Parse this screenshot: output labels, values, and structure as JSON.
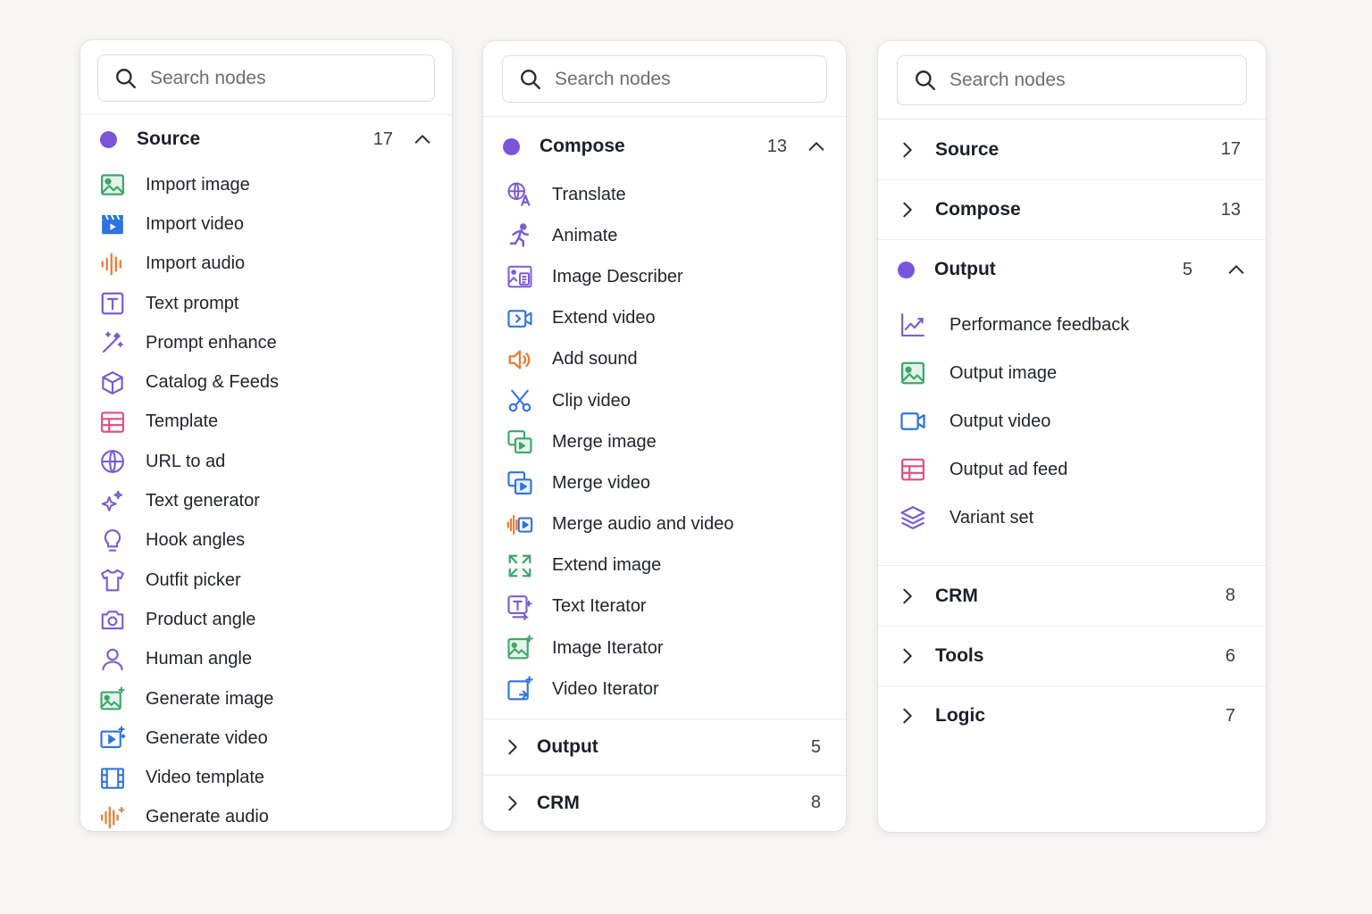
{
  "colors": {
    "accent_dot": "#7b54d9",
    "icon_green": "#3fa66a",
    "icon_blue": "#2f73e0",
    "icon_orange": "#ec7a33",
    "icon_purple": "#7b5bd6",
    "icon_pink": "#e14c7d"
  },
  "panels": [
    {
      "search_placeholder": "Search nodes",
      "expanded": {
        "title": "Source",
        "count": "17",
        "icon": "purple-dot"
      },
      "items": [
        {
          "label": "Import image",
          "icon": "image-icon"
        },
        {
          "label": "Import video",
          "icon": "clapperboard-icon"
        },
        {
          "label": "Import audio",
          "icon": "waveform-icon"
        },
        {
          "label": "Text prompt",
          "icon": "text-box-icon"
        },
        {
          "label": "Prompt enhance",
          "icon": "magic-wand-icon"
        },
        {
          "label": "Catalog & Feeds",
          "icon": "cube-icon"
        },
        {
          "label": "Template",
          "icon": "table-icon"
        },
        {
          "label": "URL to ad",
          "icon": "globe-icon"
        },
        {
          "label": "Text generator",
          "icon": "sparkles-icon"
        },
        {
          "label": "Hook angles",
          "icon": "lightbulb-icon"
        },
        {
          "label": "Outfit picker",
          "icon": "tshirt-icon"
        },
        {
          "label": "Product angle",
          "icon": "camera-icon"
        },
        {
          "label": "Human angle",
          "icon": "user-icon"
        },
        {
          "label": "Generate image",
          "icon": "image-sparkle-icon"
        },
        {
          "label": "Generate video",
          "icon": "video-sparkle-icon"
        },
        {
          "label": "Video template",
          "icon": "film-icon"
        },
        {
          "label": "Generate audio",
          "icon": "audio-sparkle-icon"
        }
      ]
    },
    {
      "search_placeholder": "Search nodes",
      "expanded": {
        "title": "Compose",
        "count": "13",
        "icon": "purple-dot"
      },
      "items": [
        {
          "label": "Translate",
          "icon": "translate-icon"
        },
        {
          "label": "Animate",
          "icon": "running-figure-icon"
        },
        {
          "label": "Image Describer",
          "icon": "image-text-icon"
        },
        {
          "label": "Extend video",
          "icon": "video-extend-icon"
        },
        {
          "label": "Add sound",
          "icon": "speaker-icon"
        },
        {
          "label": "Clip video",
          "icon": "scissors-icon"
        },
        {
          "label": "Merge image",
          "icon": "merge-image-icon"
        },
        {
          "label": "Merge video",
          "icon": "merge-video-icon"
        },
        {
          "label": "Merge audio and video",
          "icon": "merge-audio-video-icon"
        },
        {
          "label": "Extend image",
          "icon": "expand-icon"
        },
        {
          "label": "Text Iterator",
          "icon": "text-iterator-icon"
        },
        {
          "label": "Image Iterator",
          "icon": "image-iterator-icon"
        },
        {
          "label": "Video Iterator",
          "icon": "video-iterator-icon"
        }
      ],
      "collapsed": [
        {
          "title": "Output",
          "count": "5"
        },
        {
          "title": "CRM",
          "count": "8"
        }
      ]
    },
    {
      "search_placeholder": "Search nodes",
      "collapsed_top": [
        {
          "title": "Source",
          "count": "17"
        },
        {
          "title": "Compose",
          "count": "13"
        }
      ],
      "expanded": {
        "title": "Output",
        "count": "5",
        "icon": "purple-dot"
      },
      "items": [
        {
          "label": "Performance feedback",
          "icon": "line-chart-icon"
        },
        {
          "label": "Output image",
          "icon": "image-icon"
        },
        {
          "label": "Output video",
          "icon": "video-camera-icon"
        },
        {
          "label": "Output ad feed",
          "icon": "table-icon"
        },
        {
          "label": "Variant set",
          "icon": "layers-icon"
        }
      ],
      "collapsed_bottom": [
        {
          "title": "CRM",
          "count": "8"
        },
        {
          "title": "Tools",
          "count": "6"
        },
        {
          "title": "Logic",
          "count": "7"
        }
      ]
    }
  ]
}
